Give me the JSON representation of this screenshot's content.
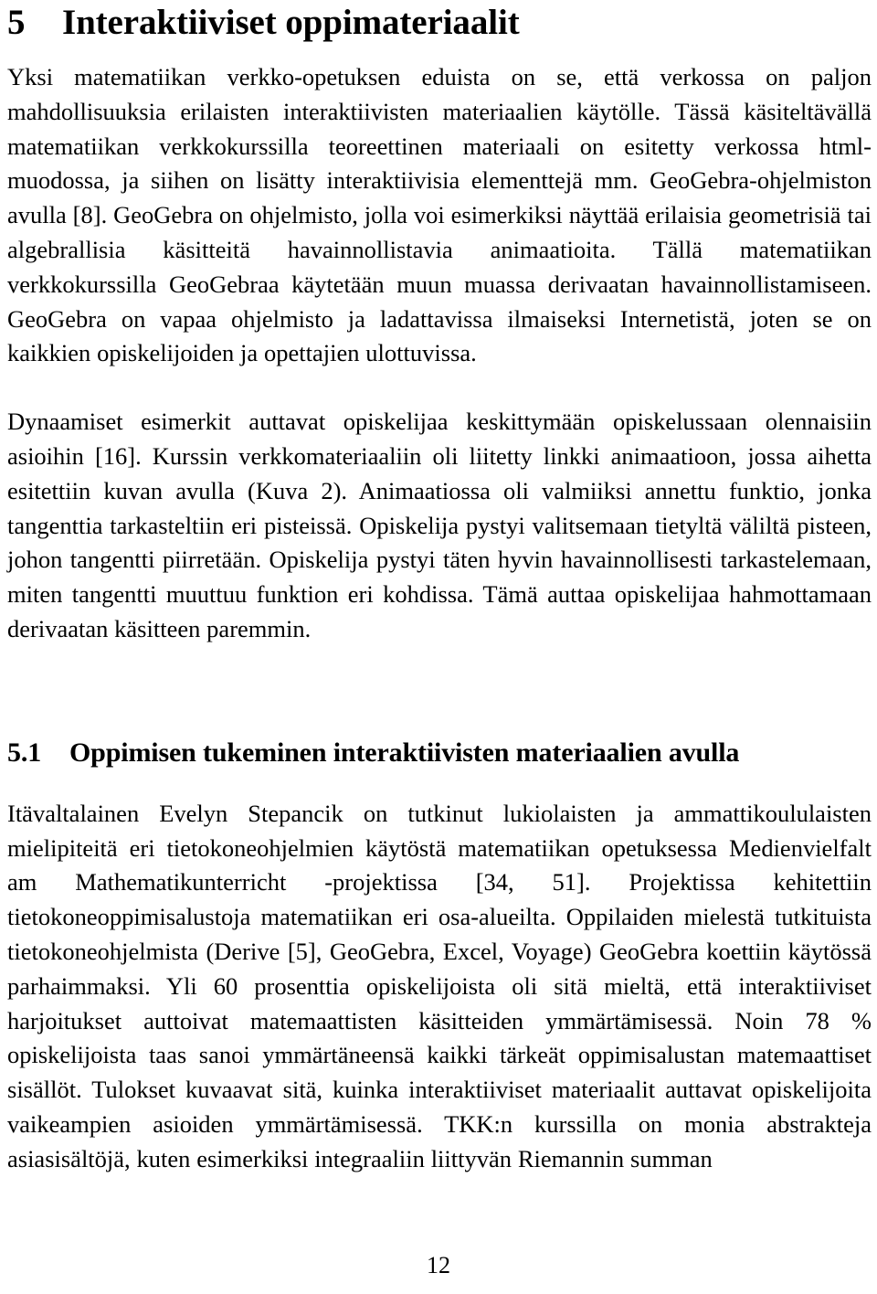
{
  "document": {
    "language": "fi",
    "page_number": "12"
  },
  "section": {
    "number": "5",
    "title": "Interaktiiviset oppimateriaalit"
  },
  "paragraphs": {
    "p1": "Yksi matematiikan verkko-opetuksen eduista on se, että verkossa on paljon mahdollisuuksia erilaisten interaktiivisten materiaalien käytölle. Tässä käsiteltävällä matematiikan verkkokurssilla teoreettinen materiaali on esitetty verkossa html-muodossa, ja siihen on lisätty interaktiivisia elementtejä mm. GeoGebra-ohjelmiston avulla [8]. GeoGebra on ohjelmisto, jolla voi esimerkiksi näyttää erilaisia geometrisiä tai algebrallisia käsitteitä havainnollistavia animaatioita. Tällä matematiikan verkkokurssilla GeoGebraa käytetään muun muassa derivaatan havainnollistamiseen. GeoGebra on vapaa ohjelmisto ja ladattavissa ilmaiseksi Internetistä, joten se on kaikkien opiskelijoiden ja opettajien ulottuvissa.",
    "p2": "Dynaamiset esimerkit auttavat opiskelijaa keskittymään opiskelussaan olennaisiin asioihin [16]. Kurssin verkkomateriaaliin oli liitetty linkki animaatioon, jossa aihetta esitettiin kuvan avulla (Kuva 2). Animaatiossa oli valmiiksi annettu funktio, jonka tangenttia tarkasteltiin eri pisteissä. Opiskelija pystyi valitsemaan tietyltä väliltä pisteen, johon tangentti piirretään. Opiskelija pystyi täten hyvin havainnollisesti tarkastelemaan, miten tangentti muuttuu funktion eri kohdissa. Tämä auttaa opiskelijaa hahmottamaan derivaatan käsitteen paremmin.",
    "p3": "Itävaltalainen Evelyn Stepancik on tutkinut lukiolaisten ja ammattikoululaisten mielipiteitä eri tietokoneohjelmien käytöstä matematiikan opetuksessa Medienvielfalt am Mathematikunterricht -projektissa [34, 51]. Projektissa kehitettiin tietokoneoppimisalustoja matematiikan eri osa-alueilta. Oppilaiden mielestä tutkituista tietokoneohjelmista (Derive [5], GeoGebra, Excel, Voyage) GeoGebra koettiin käytössä parhaimmaksi. Yli 60 prosenttia opiskelijoista oli sitä mieltä, että interaktiiviset harjoitukset auttoivat matemaattisten käsitteiden ymmärtämisessä. Noin 78 % opiskelijoista taas sanoi ymmärtäneensä kaikki tärkeät oppimisalustan matemaattiset sisällöt. Tulokset kuvaavat sitä, kuinka interaktiiviset materiaalit auttavat opiskelijoita vaikeampien asioiden ymmärtämisessä. TKK:n kurssilla on monia abstrakteja asiasisältöjä, kuten esimerkiksi integraaliin liittyvän Riemannin summan"
  },
  "subsection": {
    "number": "5.1",
    "title": "Oppimisen tukeminen interaktiivisten materiaalien avulla"
  },
  "colors": {
    "text": "#000000",
    "background": "#ffffff"
  }
}
